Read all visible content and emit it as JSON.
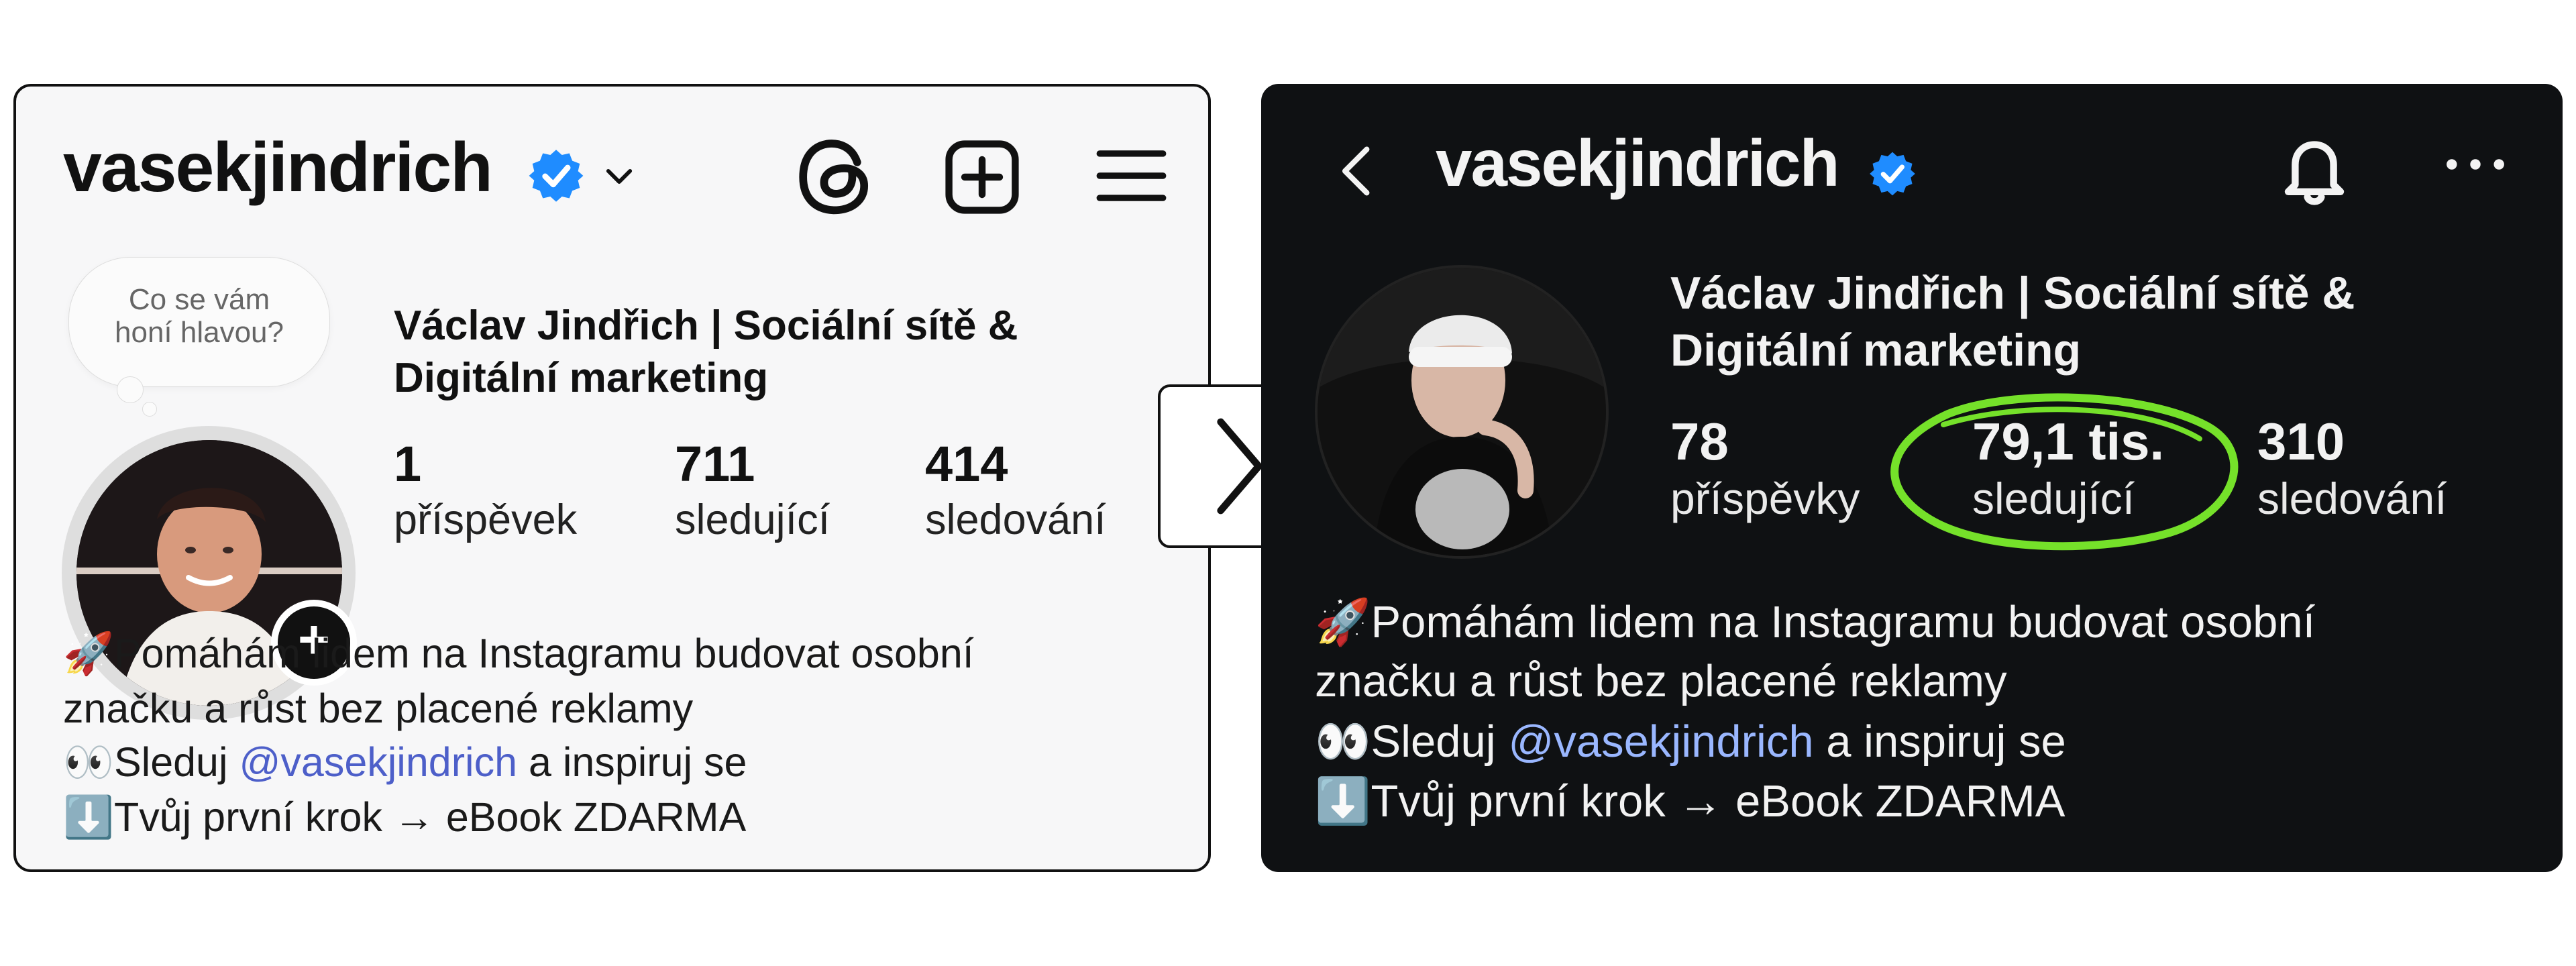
{
  "left_panel": {
    "username": "vasekjindrich",
    "speech_bubble": [
      "Co se vám",
      "honí hlavou?"
    ],
    "display_name": "Václav Jindřich | Sociální sítě & Digitální marketing",
    "stats": [
      {
        "value": "1",
        "label": "příspěvek"
      },
      {
        "value": "711",
        "label": "sledující"
      },
      {
        "value": "414",
        "label": "sledování"
      }
    ],
    "bio": {
      "line1_emoji": "🚀",
      "line1": "Pomáhám lidem na Instagramu budovat osobní",
      "line2": "značku a růst bez placené reklamy",
      "line3_emoji": "👀",
      "line3_prefix": "Sleduj ",
      "line3_mention": "@vasekjindrich",
      "line3_suffix": " a inspiruj se",
      "line4_emoji": "⬇️",
      "line4": "Tvůj první krok → eBook ZDARMA"
    },
    "icons": [
      "verified-icon",
      "chevron-down-icon",
      "threads-icon",
      "add-post-icon",
      "menu-icon",
      "add-story-icon"
    ]
  },
  "right_panel": {
    "username": "vasekjindrich",
    "display_name": "Václav Jindřich | Sociální sítě & Digitální marketing",
    "stats": [
      {
        "value": "78",
        "label": "příspěvky"
      },
      {
        "value": "79,1 tis.",
        "label": "sledující"
      },
      {
        "value": "310",
        "label": "sledování"
      }
    ],
    "bio": {
      "line1_emoji": "🚀",
      "line1": "Pomáhám lidem na Instagramu budovat osobní",
      "line2": "značku a růst bez placené reklamy",
      "line3_emoji": "👀",
      "line3_prefix": "Sleduj ",
      "line3_mention": "@vasekjindrich",
      "line3_suffix": " a inspiruj se",
      "line4_emoji": "⬇️",
      "line4": "Tvůj první krok → eBook ZDARMA"
    },
    "icons": [
      "back-arrow-icon",
      "verified-icon",
      "bell-icon",
      "more-icon"
    ]
  },
  "middle_arrow": {
    "icon": "chevron-right-icon"
  },
  "colors": {
    "verified_blue": "#1f8cff",
    "highlight_green": "#75e12a",
    "mention_left": "#4d5fc9",
    "mention_right": "#9ab7ff"
  }
}
